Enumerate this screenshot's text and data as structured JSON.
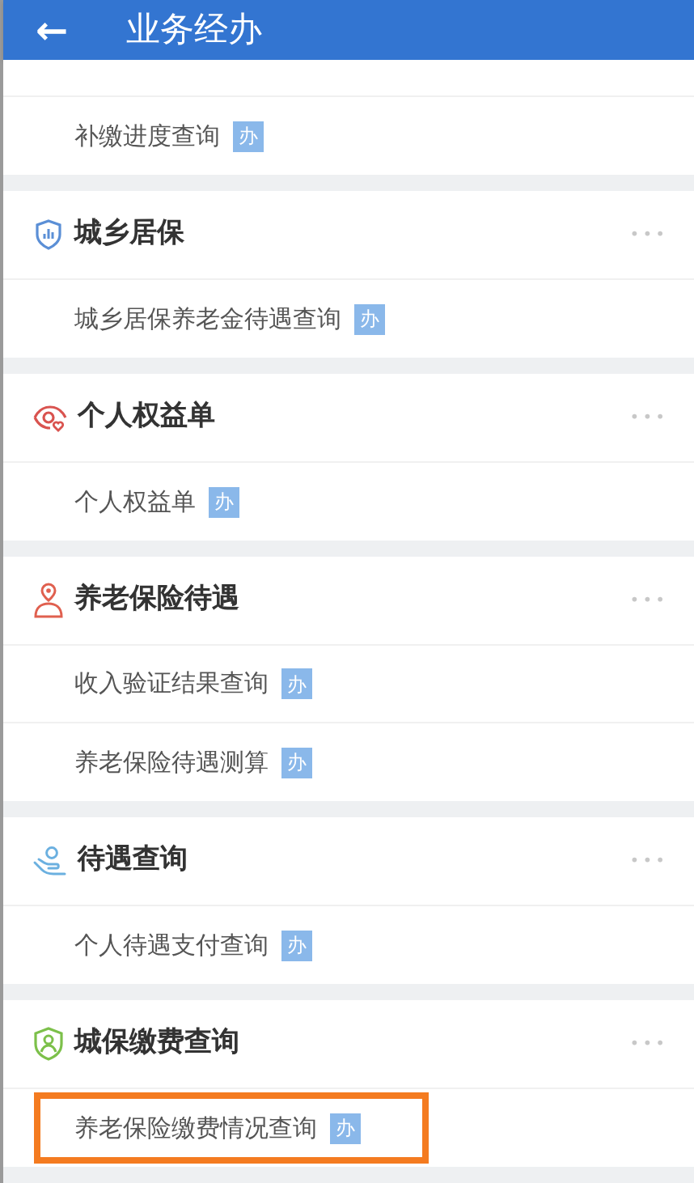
{
  "header": {
    "back": "←",
    "title": "业务经办"
  },
  "top_items": [
    {
      "label": "补缴进度查询",
      "badge": "办",
      "highlighted": false
    }
  ],
  "sections": [
    {
      "title": "城乡居保",
      "more": "•••",
      "items": [
        {
          "label": "城乡居保养老金待遇查询",
          "badge": "办",
          "highlighted": false
        }
      ]
    },
    {
      "title": "个人权益单",
      "more": "•••",
      "items": [
        {
          "label": "个人权益单",
          "badge": "办",
          "highlighted": false
        }
      ]
    },
    {
      "title": "养老保险待遇",
      "more": "•••",
      "items": [
        {
          "label": "收入验证结果查询",
          "badge": "办",
          "highlighted": false
        },
        {
          "label": "养老保险待遇测算",
          "badge": "办",
          "highlighted": false
        }
      ]
    },
    {
      "title": "待遇查询",
      "more": "•••",
      "items": [
        {
          "label": "个人待遇支付查询",
          "badge": "办",
          "highlighted": false
        }
      ]
    },
    {
      "title": "城保缴费查询",
      "more": "•••",
      "items": [
        {
          "label": "养老保险缴费情况查询",
          "badge": "办",
          "highlighted": true
        }
      ]
    }
  ]
}
